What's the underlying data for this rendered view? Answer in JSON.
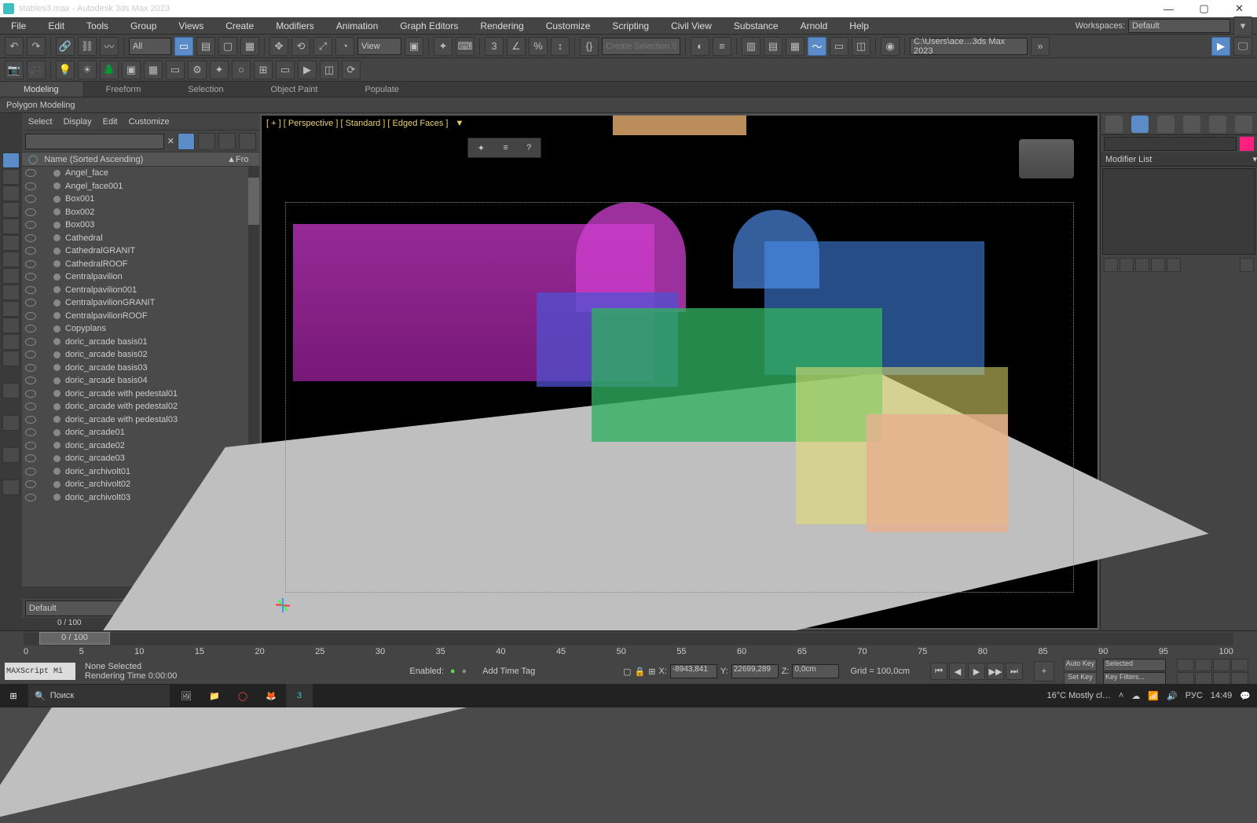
{
  "window": {
    "title": "stables3.max - Autodesk 3ds Max 2023"
  },
  "menu": {
    "items": [
      "File",
      "Edit",
      "Tools",
      "Group",
      "Views",
      "Create",
      "Modifiers",
      "Animation",
      "Graph Editors",
      "Rendering",
      "Customize",
      "Scripting",
      "Civil View",
      "Substance",
      "Arnold",
      "Help"
    ],
    "workspaces_label": "Workspaces:",
    "workspaces_value": "Default"
  },
  "toolbar1": {
    "filter_value": "All",
    "view_label": "View",
    "selset_placeholder": "Create Selection Se",
    "path_value": "C:\\Users\\ace…3ds Max 2023"
  },
  "ribbon": {
    "tabs": [
      "Modeling",
      "Freeform",
      "Selection",
      "Object Paint",
      "Populate"
    ],
    "sub": "Polygon Modeling"
  },
  "scene": {
    "menu": [
      "Select",
      "Display",
      "Edit",
      "Customize"
    ],
    "hdr_name": "Name (Sorted Ascending)",
    "hdr_frz": "Fro",
    "items": [
      {
        "name": "Angel_face",
        "dim": false
      },
      {
        "name": "Angel_face001",
        "dim": false
      },
      {
        "name": "Box001",
        "dim": false
      },
      {
        "name": "Box002",
        "dim": true
      },
      {
        "name": "Box003",
        "dim": false
      },
      {
        "name": "Cathedral",
        "dim": false
      },
      {
        "name": "CathedralGRANIT",
        "dim": false
      },
      {
        "name": "CathedralROOF",
        "dim": false
      },
      {
        "name": "Centralpavilion",
        "dim": false
      },
      {
        "name": "Centralpavilion001",
        "dim": true
      },
      {
        "name": "CentralpavilionGRANIT",
        "dim": false
      },
      {
        "name": "CentralpavilionROOF",
        "dim": false
      },
      {
        "name": "Copyplans",
        "dim": true
      },
      {
        "name": "doric_arcade basis01",
        "dim": false
      },
      {
        "name": "doric_arcade basis02",
        "dim": false
      },
      {
        "name": "doric_arcade basis03",
        "dim": false
      },
      {
        "name": "doric_arcade basis04",
        "dim": false
      },
      {
        "name": "doric_arcade with pedestal01",
        "dim": false
      },
      {
        "name": "doric_arcade with pedestal02",
        "dim": false
      },
      {
        "name": "doric_arcade with pedestal03",
        "dim": false
      },
      {
        "name": "doric_arcade01",
        "dim": false
      },
      {
        "name": "doric_arcade02",
        "dim": false
      },
      {
        "name": "doric_arcade03",
        "dim": false
      },
      {
        "name": "doric_archivolt01",
        "dim": false
      },
      {
        "name": "doric_archivolt02",
        "dim": false
      },
      {
        "name": "doric_archivolt03",
        "dim": false
      }
    ],
    "material": "Default",
    "slider_value": "0 / 100"
  },
  "viewport": {
    "label_plus": "[ + ]",
    "label_view": "[ Perspective ]",
    "label_shade": "[ Standard ]",
    "label_edge": "[ Edged Faces ]"
  },
  "rightpanel": {
    "modlist": "Modifier List"
  },
  "timeline": {
    "ticks": [
      "0",
      "5",
      "10",
      "15",
      "20",
      "25",
      "30",
      "35",
      "40",
      "45",
      "50",
      "55",
      "60",
      "65",
      "70",
      "75",
      "80",
      "85",
      "90",
      "95",
      "100"
    ],
    "knob": "0 / 100"
  },
  "status": {
    "maxscript": "MAXScript Mi",
    "line1": "None Selected",
    "line2": "Rendering Time  0:00:00",
    "enabled": "Enabled:",
    "addtag": "Add Time Tag",
    "x_lbl": "X:",
    "x_val": "-8943,841",
    "y_lbl": "Y:",
    "y_val": "22699,289",
    "z_lbl": "Z:",
    "z_val": "0,0cm",
    "grid": "Grid = 100,0cm",
    "autokey": "Auto Key",
    "setkey": "Set Key",
    "selected": "Selected",
    "keyfilters": "Key Filters..."
  },
  "taskbar": {
    "search": "Поиск",
    "weather": "16°C  Mostly cl…",
    "lang": "РУС",
    "time": "14:49"
  }
}
